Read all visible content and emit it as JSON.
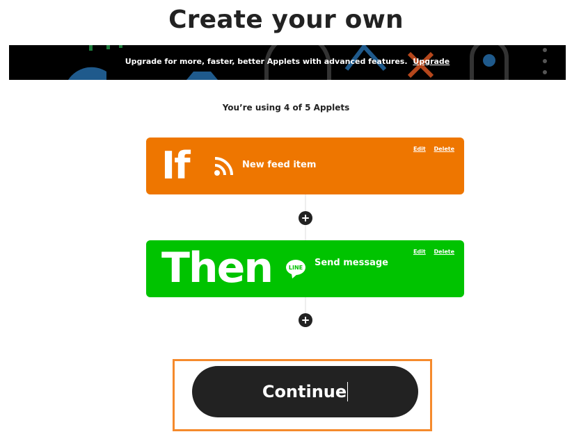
{
  "page": {
    "title": "Create your own"
  },
  "banner": {
    "text": "Upgrade for more, faster, better Applets with advanced features.",
    "link_label": "Upgrade"
  },
  "usage": {
    "text": "You’re using 4 of 5 Applets"
  },
  "trigger": {
    "keyword": "If",
    "label": "New feed item",
    "icon": "rss-icon",
    "color": "#ee7600",
    "edit_label": "Edit",
    "delete_label": "Delete"
  },
  "action": {
    "keyword": "Then",
    "label": "Send message",
    "icon": "line-icon",
    "icon_text": "LINE",
    "color": "#00c300",
    "edit_label": "Edit",
    "delete_label": "Delete"
  },
  "continue_button": {
    "label": "Continue"
  },
  "colors": {
    "dark": "#222222",
    "highlight": "#f58a2c"
  }
}
